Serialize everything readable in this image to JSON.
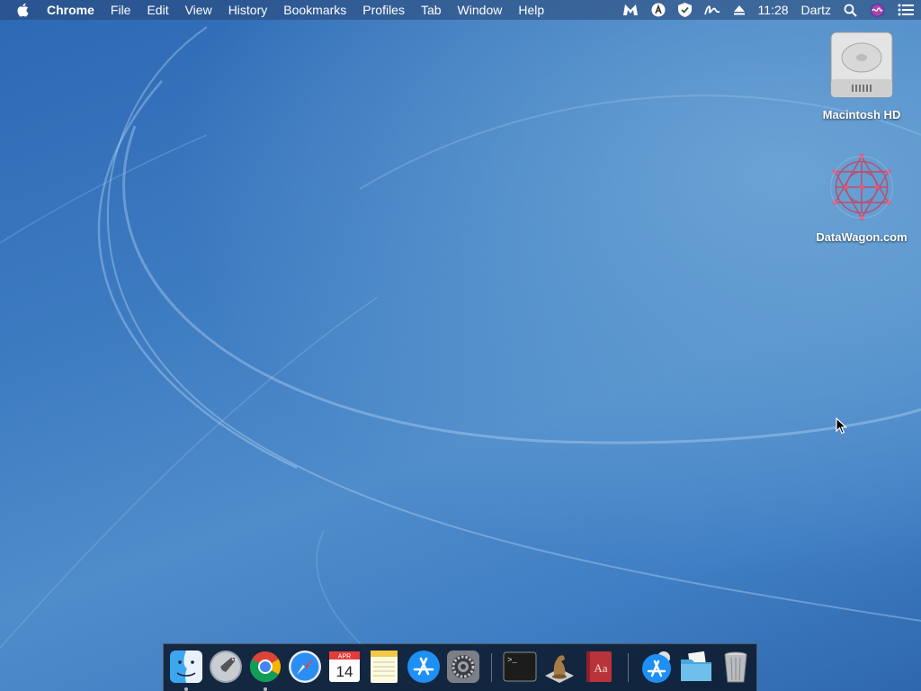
{
  "menubar": {
    "app_name": "Chrome",
    "menus": [
      "File",
      "Edit",
      "View",
      "History",
      "Bookmarks",
      "Profiles",
      "Tab",
      "Window",
      "Help"
    ],
    "clock": "11:28",
    "user": "Dartz",
    "status_icons": [
      "malwarebytes-icon",
      "antivirus-icon",
      "shield-check-icon",
      "signature-icon",
      "eject-icon",
      "search-icon",
      "siri-icon",
      "notification-center-icon"
    ]
  },
  "desktop_icons": [
    {
      "label": "Macintosh HD",
      "icon": "hard-drive-icon"
    },
    {
      "label": "DataWagon.com",
      "icon": "datawagon-icon"
    }
  ],
  "dock": {
    "items": [
      {
        "name": "finder",
        "running": true
      },
      {
        "name": "launchpad",
        "running": false
      },
      {
        "name": "chrome",
        "running": true
      },
      {
        "name": "safari",
        "running": false
      },
      {
        "name": "calendar",
        "running": false,
        "month": "APR",
        "day": "14"
      },
      {
        "name": "notes",
        "running": false
      },
      {
        "name": "app-store",
        "running": false
      },
      {
        "name": "system-preferences",
        "running": false
      },
      {
        "name": "terminal",
        "running": false,
        "prompt": ">_"
      },
      {
        "name": "chess",
        "running": false
      },
      {
        "name": "dictionary",
        "running": false,
        "glyph": "Aa"
      },
      {
        "name": "app-store-downloads",
        "running": false
      },
      {
        "name": "documents-folder",
        "running": false
      },
      {
        "name": "trash",
        "running": false
      }
    ]
  },
  "colors": {
    "wallpaper_dark": "#2d68b3",
    "wallpaper_light": "#6aa3d4",
    "dock_bg": "#0a1423"
  }
}
